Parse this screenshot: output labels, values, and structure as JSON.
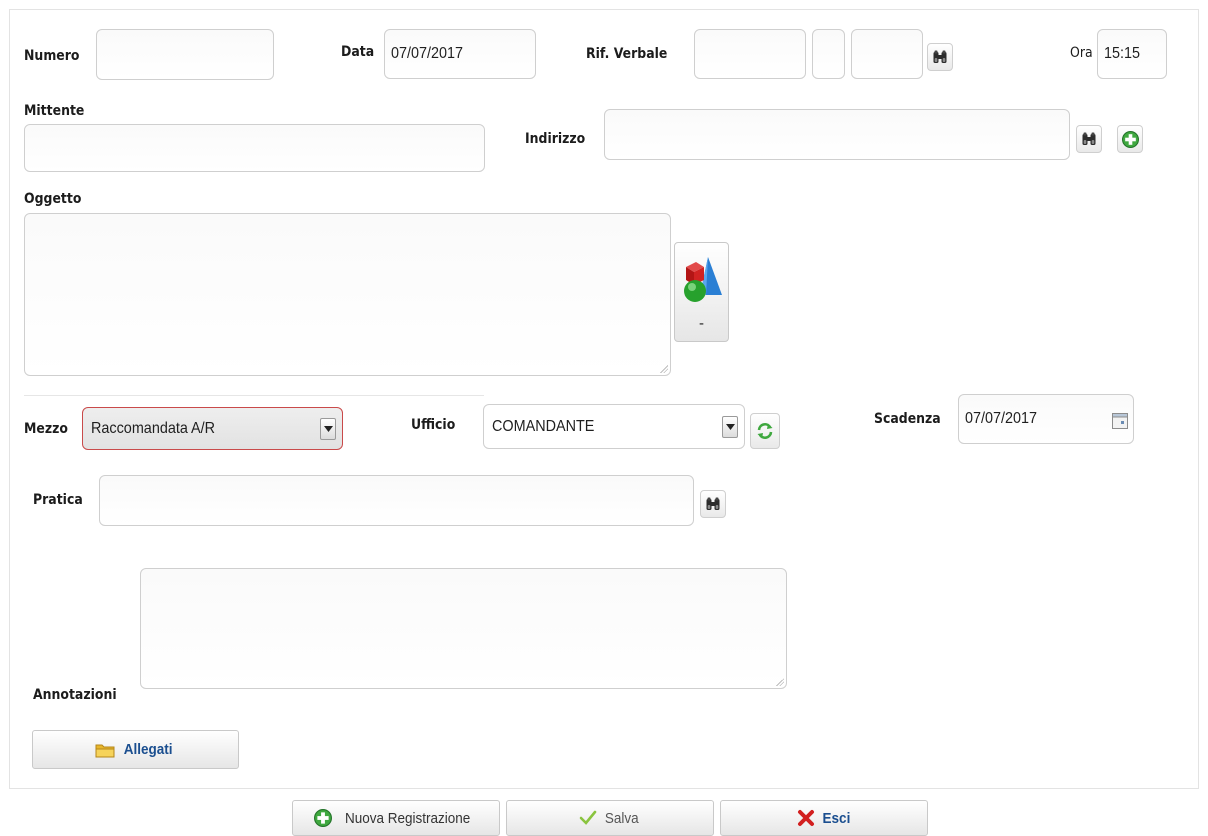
{
  "form": {
    "numero": {
      "label": "Numero",
      "value": ""
    },
    "data": {
      "label": "Data",
      "value": "07/07/2017"
    },
    "rif_verbale": {
      "label": "Rif. Verbale",
      "value1": "",
      "value2": "",
      "value3": ""
    },
    "ora": {
      "label": "Ora",
      "value": "15:15"
    },
    "mittente": {
      "label": "Mittente",
      "value": ""
    },
    "indirizzo": {
      "label": "Indirizzo",
      "value": ""
    },
    "oggetto": {
      "label": "Oggetto",
      "value": ""
    },
    "classify_button": {
      "label": "-"
    },
    "mezzo": {
      "label": "Mezzo",
      "selected": "Raccomandata A/R"
    },
    "ufficio": {
      "label": "Ufficio",
      "selected": "COMANDANTE"
    },
    "scadenza": {
      "label": "Scadenza",
      "value": "07/07/2017"
    },
    "pratica": {
      "label": "Pratica",
      "value": ""
    },
    "annotazioni": {
      "label": "Annotazioni",
      "value": ""
    },
    "allegati_button": {
      "label": "Allegati"
    }
  },
  "footer": {
    "new_label": "Nuova Registrazione",
    "save_label": "Salva",
    "exit_label": "Esci"
  },
  "colors": {
    "accent_text": "#1a4e8f",
    "mezzo_border": "#c94a4a",
    "green_icon": "#3fa83f",
    "red_icon": "#d21f1f"
  },
  "icons": {
    "search": "binoculars-icon",
    "add": "green-plus-icon",
    "refresh": "refresh-icon",
    "calendar": "calendar-icon",
    "shapes": "shapes-icon",
    "folder": "folder-icon",
    "check": "check-icon",
    "close": "red-x-icon"
  }
}
